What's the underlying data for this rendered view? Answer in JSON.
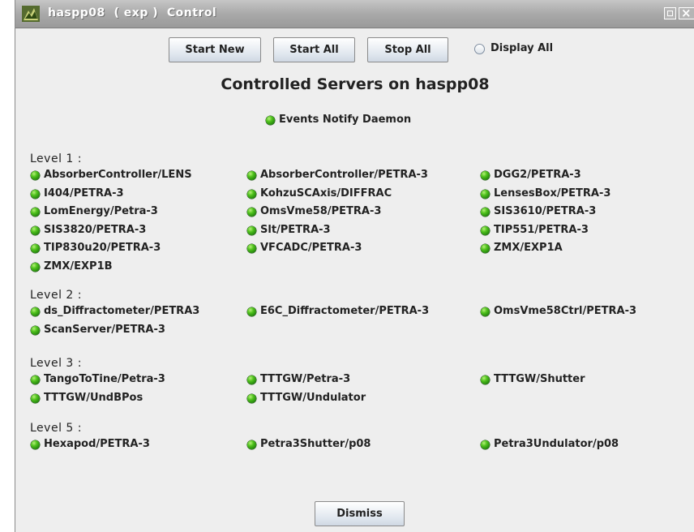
{
  "window": {
    "title": "haspp08  ( exp )  Control"
  },
  "toolbar": {
    "start_new": "Start New",
    "start_all": "Start All",
    "stop_all": "Stop All",
    "display_all": "Display All",
    "display_all_selected": false
  },
  "heading": "Controlled Servers on haspp08",
  "notify": {
    "label": "Events Notify Daemon",
    "status": "running"
  },
  "levels": [
    {
      "label": "Level  1 :",
      "servers": [
        "AbsorberController/LENS",
        "AbsorberController/PETRA-3",
        "DGG2/PETRA-3",
        "I404/PETRA-3",
        "KohzuSCAxis/DIFFRAC",
        "LensesBox/PETRA-3",
        "LomEnergy/Petra-3",
        "OmsVme58/PETRA-3",
        "SIS3610/PETRA-3",
        "SIS3820/PETRA-3",
        "Slt/PETRA-3",
        "TIP551/PETRA-3",
        "TIP830u20/PETRA-3",
        "VFCADC/PETRA-3",
        "ZMX/EXP1A",
        "ZMX/EXP1B"
      ]
    },
    {
      "label": "Level  2 :",
      "servers": [
        "ds_Diffractometer/PETRA3",
        "E6C_Diffractometer/PETRA-3",
        "OmsVme58Ctrl/PETRA-3",
        "ScanServer/PETRA-3"
      ]
    },
    {
      "label": "Level  3 :",
      "servers": [
        "TangoToTine/Petra-3",
        "TTTGW/Petra-3",
        "TTTGW/Shutter",
        "TTTGW/UndBPos",
        "TTTGW/Undulator"
      ]
    },
    {
      "label": "Level  5 :",
      "servers": [
        "Hexapod/PETRA-3",
        "Petra3Shutter/p08",
        "Petra3Undulator/p08"
      ]
    }
  ],
  "dismiss_label": "Dismiss",
  "colors": {
    "status_running": "#2fa312",
    "title_bar": "#a9a9a9",
    "button_face": "#dfe6ee"
  }
}
